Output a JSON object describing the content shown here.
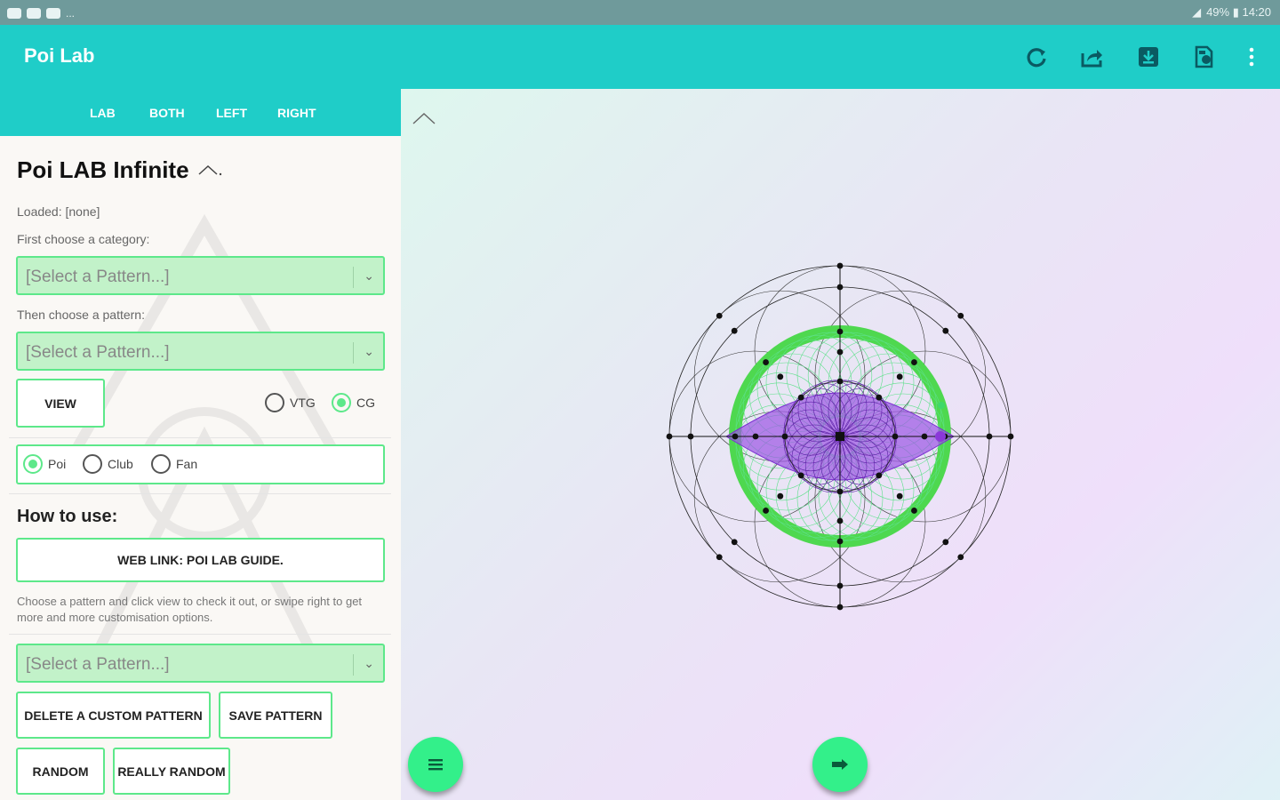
{
  "status_bar": {
    "right_text": "49% ▮ 14:20",
    "dots_text": "..."
  },
  "app_bar": {
    "title": "Poi Lab",
    "actions": [
      "refresh-icon",
      "share-icon",
      "download-icon",
      "save-file-icon",
      "more-vert-icon"
    ]
  },
  "tabs": [
    {
      "label": "LAB",
      "selected": true
    },
    {
      "label": "BOTH",
      "selected": false
    },
    {
      "label": "LEFT",
      "selected": false
    },
    {
      "label": "RIGHT",
      "selected": false
    }
  ],
  "panel": {
    "title": "Poi LAB Infinite",
    "loaded_label": "Loaded: [none]",
    "category_label": "First choose a category:",
    "category_select": "[Select a Pattern...]",
    "pattern_label": "Then choose a pattern:",
    "pattern_select": "[Select a Pattern...]",
    "view_button": "VIEW",
    "mode_options": [
      {
        "label": "VTG",
        "selected": false
      },
      {
        "label": "CG",
        "selected": true
      }
    ],
    "prop_options": [
      {
        "label": "Poi",
        "selected": true
      },
      {
        "label": "Club",
        "selected": false
      },
      {
        "label": "Fan",
        "selected": false
      }
    ],
    "how_to_heading": "How to use:",
    "guide_button": "WEB LINK: POI LAB GUIDE.",
    "description": "Choose a pattern and click view to check it out, or swipe right to get more and more customisation options.",
    "custom_select": "[Select a Pattern...]",
    "delete_button": "DELETE A CUSTOM PATTERN",
    "save_button": "SAVE PATTERN",
    "random_button": "RANDOM",
    "really_random_button": "REALLY RANDOM"
  },
  "colors": {
    "accent": "#1fcdc8",
    "green": "#5de88a",
    "fab": "#33f08a",
    "purple": "#8b38d9"
  }
}
